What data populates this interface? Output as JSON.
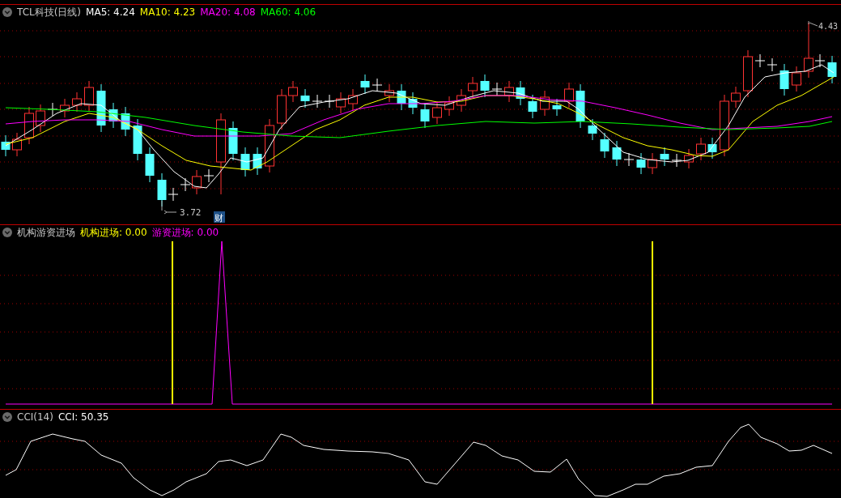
{
  "main_panel": {
    "title": "TCL科技(日线)",
    "indicators": [
      {
        "label": "MA5: 4.24",
        "color": "#ffffff"
      },
      {
        "label": "MA10: 4.23",
        "color": "#ffff00"
      },
      {
        "label": "MA20: 4.08",
        "color": "#ff00ff"
      },
      {
        "label": "MA60: 4.06",
        "color": "#00ff00"
      }
    ],
    "high_label": "4.43",
    "low_label": "3.72",
    "finance_badge": "财"
  },
  "signal_panel": {
    "title": "机构游资进场",
    "indicators": [
      {
        "label": "机构进场: 0.00",
        "color": "#ffff00"
      },
      {
        "label": "游资进场: 0.00",
        "color": "#ff00ff"
      }
    ]
  },
  "cci_panel": {
    "title": "CCI(14)",
    "indicators": [
      {
        "label": "CCI: 50.35",
        "color": "#ffffff"
      }
    ]
  }
}
